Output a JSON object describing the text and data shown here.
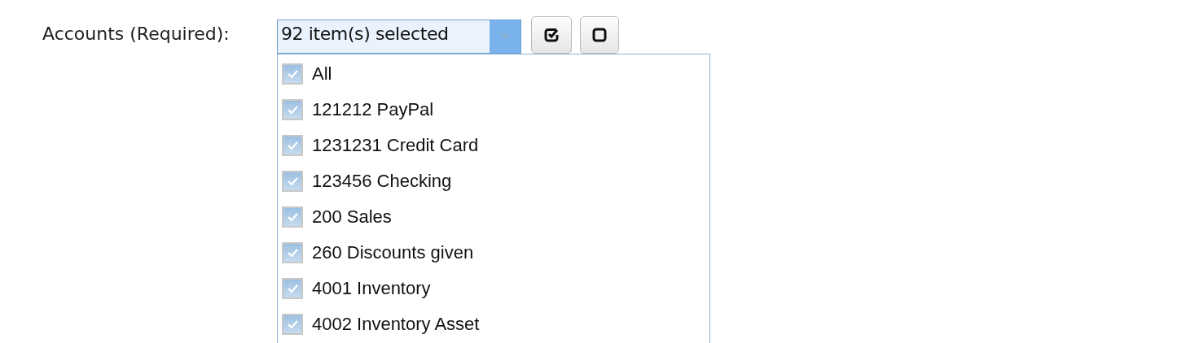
{
  "field": {
    "label": "Accounts (Required):",
    "value": "92 item(s) selected",
    "expanded": true
  },
  "buttons": [
    {
      "kind": "select-all"
    },
    {
      "kind": "select-none"
    }
  ],
  "options": [
    {
      "label": "All",
      "checked": true
    },
    {
      "label": "121212 PayPal",
      "checked": true
    },
    {
      "label": "1231231 Credit Card",
      "checked": true
    },
    {
      "label": "123456 Checking",
      "checked": true
    },
    {
      "label": "200 Sales",
      "checked": true
    },
    {
      "label": "260 Discounts given",
      "checked": true
    },
    {
      "label": "4001 Inventory",
      "checked": true
    },
    {
      "label": "4002 Inventory Asset",
      "checked": true
    }
  ]
}
